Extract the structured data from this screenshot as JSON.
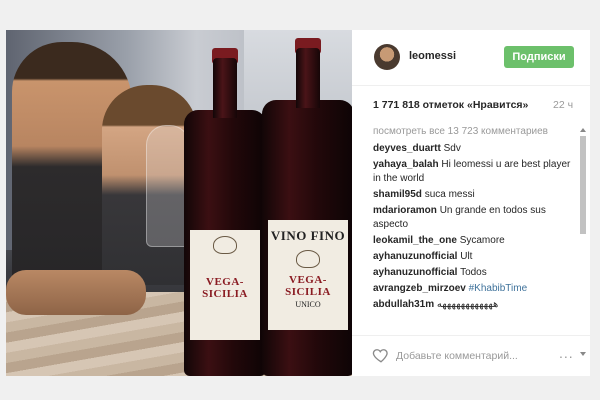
{
  "photo": {
    "bottle_left_label": "VEGA-SICILIA",
    "bottle_right_label_top": "VINO FINO",
    "bottle_right_label_brand": "VEGA-SICILIA",
    "bottle_right_label_sub": "UNICO"
  },
  "header": {
    "username": "leomessi",
    "follow_label": "Подписки"
  },
  "stats": {
    "likes": "1 771 818 отметок «Нравится»",
    "time": "22 ч"
  },
  "view_all": "посмотреть все 13 723 комментариев",
  "comments": [
    {
      "user": "deyves_duartt",
      "text": "Sdv"
    },
    {
      "user": "yahaya_balah",
      "text": "Hi leomessi u are best player in the world"
    },
    {
      "user": "shamil95d",
      "text": "suca messi"
    },
    {
      "user": "mdarioramon",
      "text": "Un grande en todos sus aspecto"
    },
    {
      "user": "leokamil_the_one",
      "text": "Sycamore"
    },
    {
      "user": "ayhanuzunofficial",
      "text": "Ult"
    },
    {
      "user": "ayhanuzunofficial",
      "text": "Todos"
    },
    {
      "user": "avrangzeb_mirzoev",
      "text": "",
      "hashtag": "#KhabibTime"
    },
    {
      "user": "abdullah31m",
      "text": "ههههههههههههه"
    }
  ],
  "footer": {
    "add_comment_placeholder": "Добавьте комментарий...",
    "more": "..."
  },
  "colors": {
    "follow_button": "#6cc06b",
    "hashtag": "#3f729b"
  },
  "icons": [
    "heart-icon",
    "more-options-icon"
  ]
}
